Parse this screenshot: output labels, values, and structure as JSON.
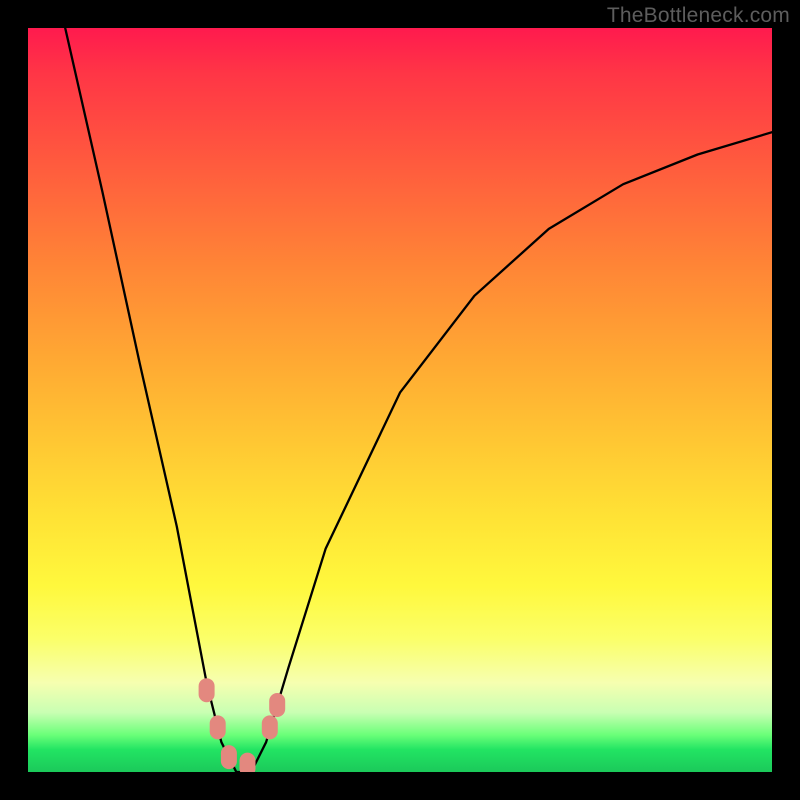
{
  "watermark": "TheBottleneck.com",
  "chart_data": {
    "type": "line",
    "title": "",
    "xlabel": "",
    "ylabel": "",
    "xlim": [
      0,
      100
    ],
    "ylim": [
      0,
      100
    ],
    "background_gradient": {
      "direction": "vertical",
      "stops": [
        {
          "pos": 0,
          "color": "#ff1a4e"
        },
        {
          "pos": 18,
          "color": "#ff5a3e"
        },
        {
          "pos": 44,
          "color": "#ffa733"
        },
        {
          "pos": 66,
          "color": "#ffe335"
        },
        {
          "pos": 82,
          "color": "#fbff68"
        },
        {
          "pos": 92,
          "color": "#c9ffb3"
        },
        {
          "pos": 97,
          "color": "#22e463"
        },
        {
          "pos": 100,
          "color": "#1bc95a"
        }
      ]
    },
    "series": [
      {
        "name": "bottleneck-curve",
        "color": "#000000",
        "x": [
          5,
          10,
          15,
          20,
          24,
          26,
          28,
          30,
          32,
          35,
          40,
          50,
          60,
          70,
          80,
          90,
          100
        ],
        "y": [
          100,
          78,
          55,
          33,
          12,
          4,
          0,
          0,
          4,
          14,
          30,
          51,
          64,
          73,
          79,
          83,
          86
        ]
      }
    ],
    "markers": {
      "name": "highlight-dots",
      "color": "#e3887f",
      "points": [
        {
          "x": 24.0,
          "y": 11
        },
        {
          "x": 25.5,
          "y": 6
        },
        {
          "x": 27.0,
          "y": 2
        },
        {
          "x": 29.5,
          "y": 1
        },
        {
          "x": 32.5,
          "y": 6
        },
        {
          "x": 33.5,
          "y": 9
        }
      ]
    }
  }
}
